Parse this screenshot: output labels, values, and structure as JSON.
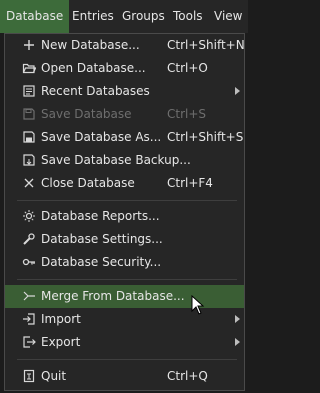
{
  "menubar": {
    "items": [
      {
        "label": "Database"
      },
      {
        "label": "Entries"
      },
      {
        "label": "Groups"
      },
      {
        "label": "Tools"
      },
      {
        "label": "View"
      }
    ]
  },
  "menu": {
    "items": [
      {
        "label": "New Database...",
        "shortcut": "Ctrl+Shift+N",
        "icon": "plus-icon"
      },
      {
        "label": "Open Database...",
        "shortcut": "Ctrl+O",
        "icon": "folder-open-icon"
      },
      {
        "label": "Recent Databases",
        "shortcut": "",
        "icon": "recent-icon",
        "submenu": true
      },
      {
        "label": "Save Database",
        "shortcut": "Ctrl+S",
        "icon": "save-icon",
        "disabled": true
      },
      {
        "label": "Save Database As...",
        "shortcut": "Ctrl+Shift+S",
        "icon": "save-as-icon"
      },
      {
        "label": "Save Database Backup...",
        "shortcut": "",
        "icon": "save-backup-icon"
      },
      {
        "label": "Close Database",
        "shortcut": "Ctrl+F4",
        "icon": "close-icon"
      },
      {
        "label": "Database Reports...",
        "shortcut": "",
        "icon": "reports-icon"
      },
      {
        "label": "Database Settings...",
        "shortcut": "",
        "icon": "wrench-icon"
      },
      {
        "label": "Database Security...",
        "shortcut": "",
        "icon": "key-icon"
      },
      {
        "label": "Merge From Database...",
        "shortcut": "",
        "icon": "merge-icon",
        "highlighted": true
      },
      {
        "label": "Import",
        "shortcut": "",
        "icon": "import-icon",
        "submenu": true
      },
      {
        "label": "Export",
        "shortcut": "",
        "icon": "export-icon",
        "submenu": true
      },
      {
        "label": "Quit",
        "shortcut": "Ctrl+Q",
        "icon": "quit-icon"
      }
    ]
  },
  "colors": {
    "highlight": "#3a5e34",
    "active_menu": "#3d6b3a",
    "menu_bg": "#262626",
    "text": "#e6e6e6",
    "disabled_text": "#6e6e6e"
  }
}
